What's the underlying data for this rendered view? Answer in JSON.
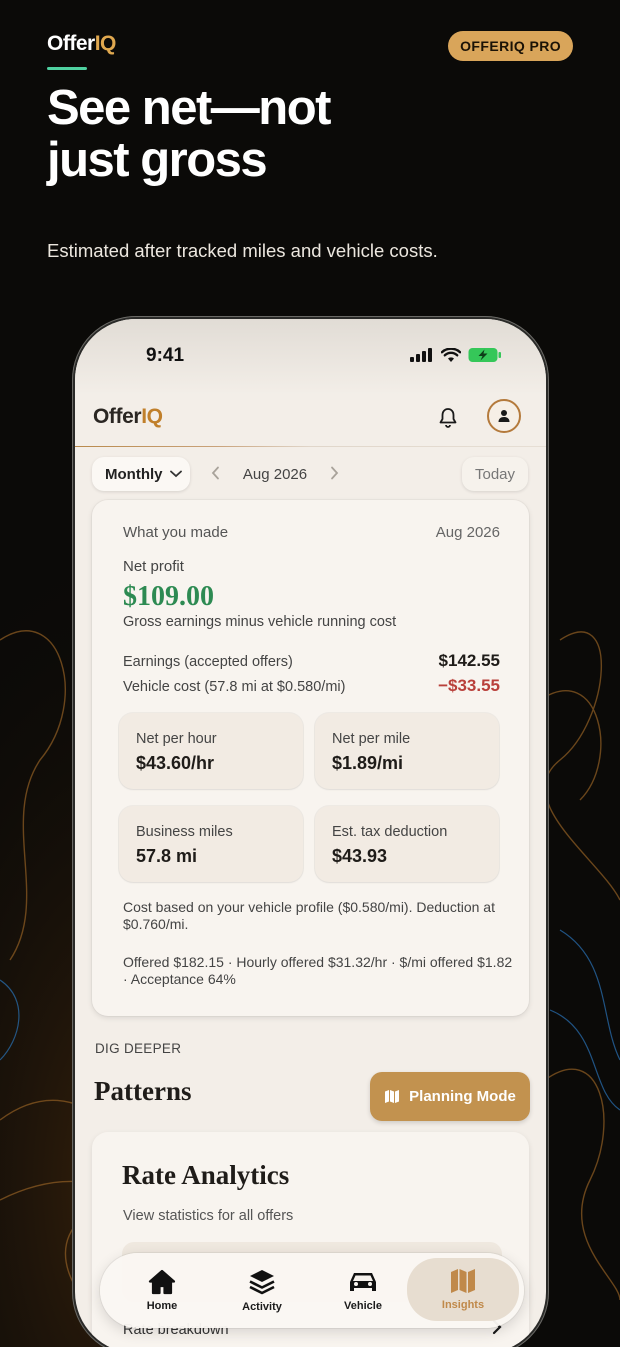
{
  "brand": {
    "name_prefix": "Offer",
    "name_suffix": "IQ"
  },
  "badge": "OFFERIQ PRO",
  "headline": {
    "line1": "See net—not",
    "line2": "just gross"
  },
  "subhead": "Estimated after tracked miles and vehicle costs.",
  "colors": {
    "accent_gold": "#d9a55a",
    "profit_green": "#2d8a52",
    "cost_red": "#b9403b",
    "underline_green": "#4fd1a0"
  },
  "status_bar": {
    "time": "9:41"
  },
  "app": {
    "logo_prefix": "Offer",
    "logo_suffix": "IQ",
    "period_selector": "Monthly",
    "current_month": "Aug 2026",
    "today_label": "Today"
  },
  "summary": {
    "title": "What you made",
    "period": "Aug 2026",
    "net_profit_label": "Net profit",
    "net_profit_value": "$109.00",
    "net_profit_sub": "Gross earnings minus vehicle running cost",
    "earnings_label": "Earnings (accepted offers)",
    "earnings_value": "$142.55",
    "cost_label": "Vehicle cost (57.8 mi at $0.580/mi)",
    "cost_value": "−$33.55",
    "tiles": [
      {
        "label": "Net per hour",
        "value": "$43.60/hr"
      },
      {
        "label": "Net per mile",
        "value": "$1.89/mi"
      },
      {
        "label": "Business miles",
        "value": "57.8 mi"
      },
      {
        "label": "Est. tax deduction",
        "value": "$43.93"
      }
    ],
    "note_cost": "Cost based on your vehicle profile ($0.580/mi). Deduction at $0.760/mi.",
    "note_offered": "Offered $182.15 · Hourly offered $31.32/hr · $/mi offered $1.82 · Acceptance 64%"
  },
  "dig_deeper": {
    "kicker": "DIG DEEPER",
    "title": "Patterns",
    "planning_button": "Planning Mode"
  },
  "rate_analytics": {
    "title": "Rate Analytics",
    "subtitle": "View statistics for all offers",
    "breakdown_label": "Rate breakdown"
  },
  "tabs": [
    {
      "label": "Home",
      "icon": "house-icon"
    },
    {
      "label": "Activity",
      "icon": "layers-icon"
    },
    {
      "label": "Vehicle",
      "icon": "car-icon"
    },
    {
      "label": "Insights",
      "icon": "map-icon"
    }
  ]
}
